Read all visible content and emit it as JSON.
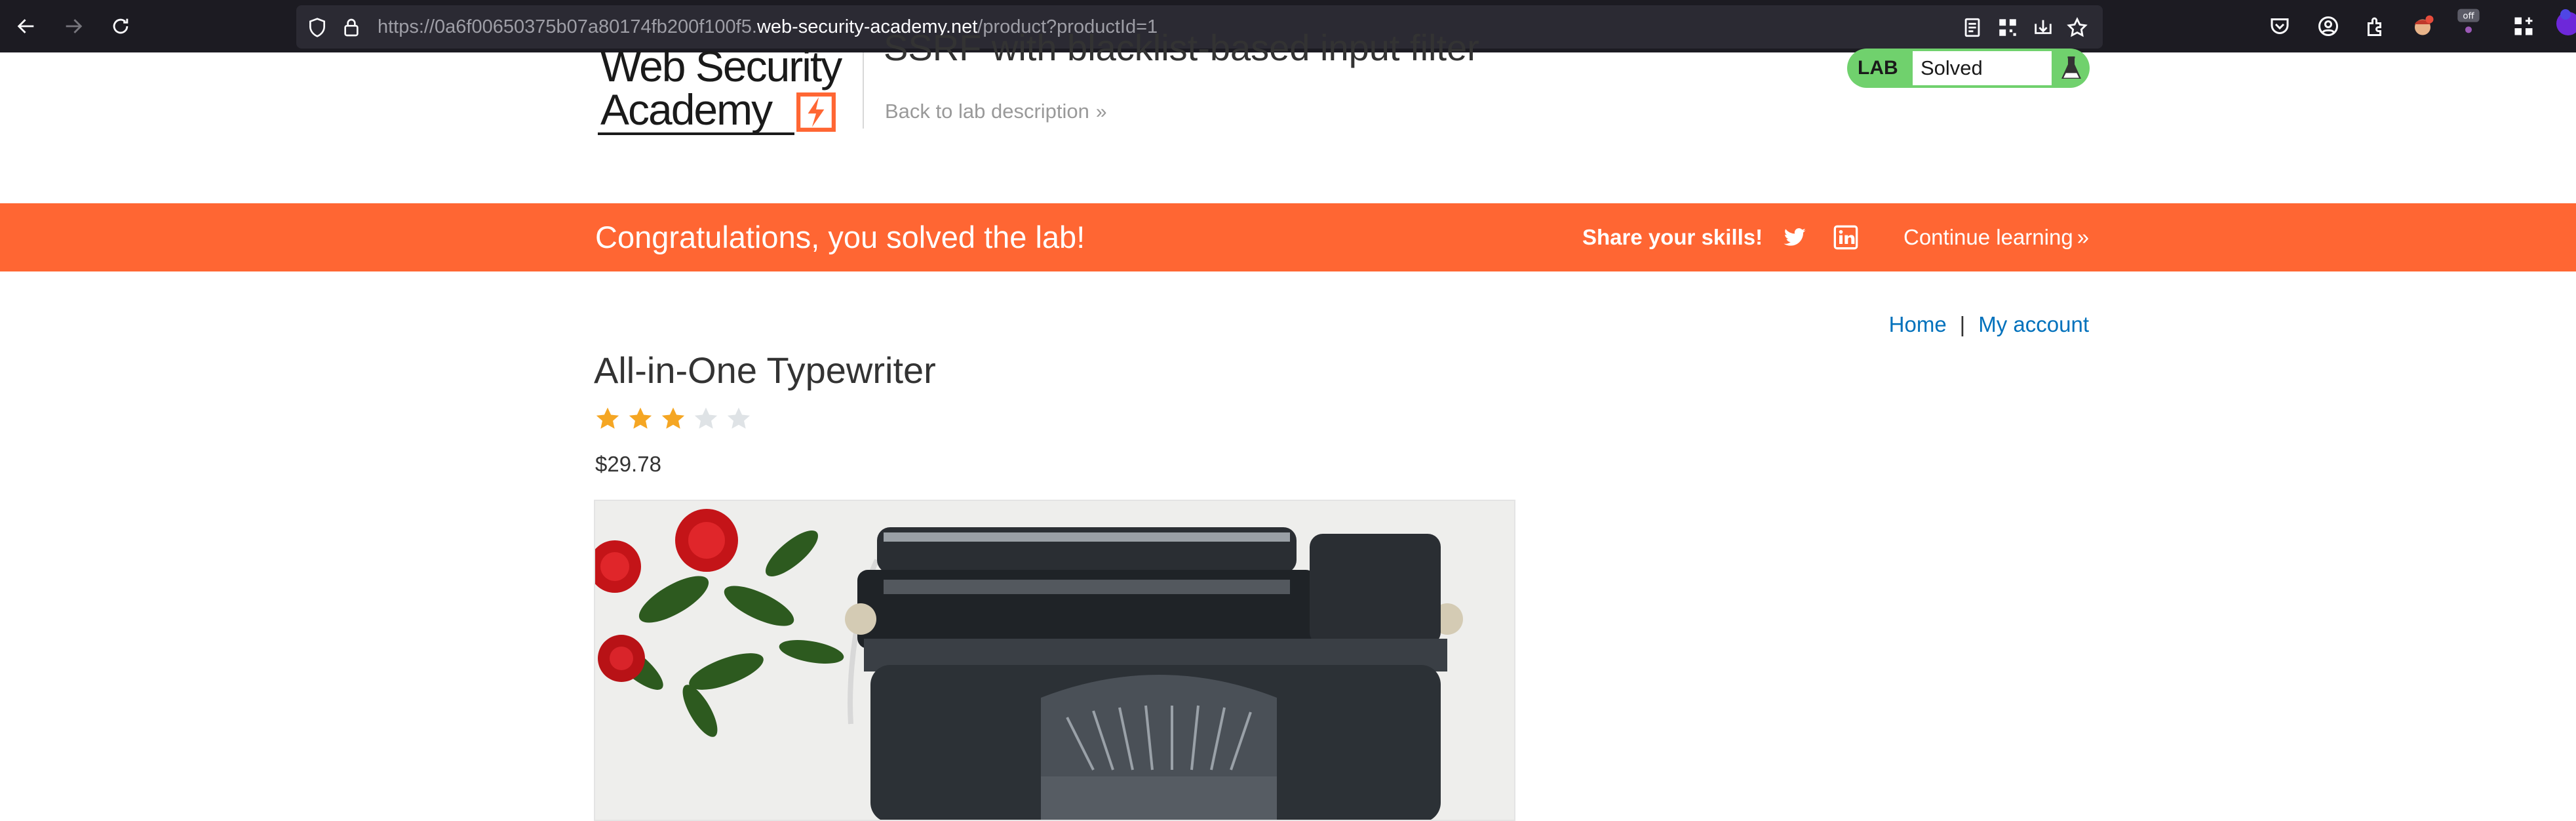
{
  "browser": {
    "url_prefix": "https://0a6f00650375b07a80174fb200f100f5.",
    "url_domain": "web-security-academy.net",
    "url_path": "/product?productId=1"
  },
  "header": {
    "logo_line1": "Web Security",
    "logo_line2": "Academy",
    "lab_title": "SSRF with blacklist-based input filter",
    "back_link": "Back to lab description",
    "lab_tag": "LAB",
    "lab_status": "Solved"
  },
  "banner": {
    "message": "Congratulations, you solved the lab!",
    "share_label": "Share your skills!",
    "continue_label": "Continue learning"
  },
  "nav": {
    "home": "Home",
    "separator": "|",
    "account": "My account"
  },
  "product": {
    "title": "All-in-One Typewriter",
    "rating": 3,
    "rating_max": 5,
    "price": "$29.78"
  },
  "colors": {
    "brand_orange": "#ff6633",
    "lab_green": "#70d16d",
    "link_blue": "#0071bc",
    "star_filled": "#f5a623",
    "star_empty": "#dfe3e6"
  }
}
